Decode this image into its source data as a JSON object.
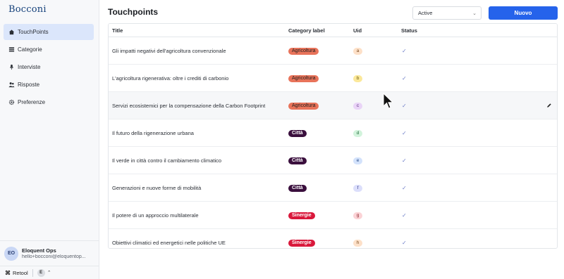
{
  "sidebar": {
    "brand": "Bocconi",
    "items": [
      {
        "label": "TouchPoints",
        "icon": "home-icon",
        "active": true
      },
      {
        "label": "Categorie",
        "icon": "list-icon",
        "active": false
      },
      {
        "label": "Interviste",
        "icon": "microphone-icon",
        "active": false
      },
      {
        "label": "Risposte",
        "icon": "users-icon",
        "active": false
      },
      {
        "label": "Preferenze",
        "icon": "gear-icon",
        "active": false
      }
    ],
    "user": {
      "initials": "EO",
      "name": "Eloquent Ops",
      "email": "hello+bocconi@eloquentop..."
    },
    "footer": {
      "logo_label": "Retool",
      "account_initial": "E"
    }
  },
  "header": {
    "title": "Touchpoints",
    "status_select_value": "Active",
    "new_button_label": "Nuovo"
  },
  "table": {
    "columns": [
      "Title",
      "Category label",
      "Uid",
      "Status"
    ],
    "rows": [
      {
        "title": "Gli impatti negativi dell'agricoltura convenzionale",
        "category": "Agricoltura",
        "uid": "a"
      },
      {
        "title": "L'agricoltura rigenerativa: oltre i crediti di carbonio",
        "category": "Agricoltura",
        "uid": "b"
      },
      {
        "title": "Servizi ecosistemici per la compensazione della Carbon Footprint",
        "category": "Agricoltura",
        "uid": "c"
      },
      {
        "title": "Il futuro della rigenerazione urbana",
        "category": "Città",
        "uid": "d"
      },
      {
        "title": "Il verde in città contro il cambiamento climatico",
        "category": "Città",
        "uid": "e"
      },
      {
        "title": "Generazioni e nuove forme di mobilità",
        "category": "Città",
        "uid": "f"
      },
      {
        "title": "Il potere di un approccio multilaterale",
        "category": "Sinergie",
        "uid": "g"
      },
      {
        "title": "Obiettivi climatici ed energetici nelle politiche UE",
        "category": "Sinergie",
        "uid": "h"
      }
    ]
  },
  "colors": {
    "accent": "#2563eb",
    "agricoltura_tag": "#e8735a",
    "citta_tag": "#3a0f3d",
    "sinergie_tag": "#d9183b",
    "active_nav": "#dbe6fb"
  }
}
